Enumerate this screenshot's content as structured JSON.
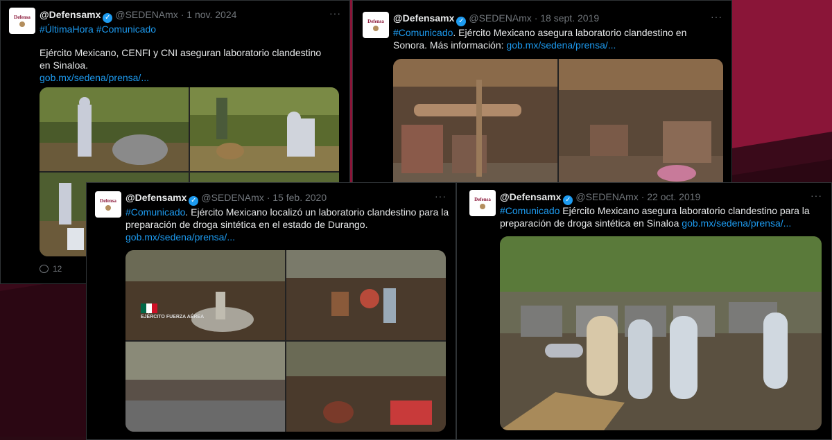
{
  "colors": {
    "brand": "#8a1538",
    "card_bg": "#000000",
    "link": "#1d9bf0",
    "muted": "#71767b",
    "text": "#e7e9ea",
    "verified": "#1d9bf0"
  },
  "avatar_label": "Defensa",
  "tweets": [
    {
      "name": "@Defensamx",
      "handle": "@SEDENAmx",
      "date": "1 nov. 2024",
      "hashtags": "#ÚltimaHora #Comunicado",
      "body": "Ejército Mexicano, CENFI y CNI aseguran laboratorio clandestino en Sinaloa.",
      "link": "gob.mx/sedena/prensa/...",
      "replies": "12"
    },
    {
      "name": "@Defensamx",
      "handle": "@SEDENAmx",
      "date": "18 sept. 2019",
      "hashtag": "#Comunicado",
      "body": ". Ejército Mexicano asegura laboratorio clandestino en Sonora. Más información:",
      "link": "gob.mx/sedena/prensa/..."
    },
    {
      "name": "@Defensamx",
      "handle": "@SEDENAmx",
      "date": "15 feb. 2020",
      "hashtag": "#Comunicado",
      "body": ". Ejército Mexicano localizó un laboratorio clandestino para la preparación de droga sintética en el estado de Durango.",
      "link": "gob.mx/sedena/prensa/...",
      "watermark": "EJÉRCITO FUERZA AÉREA"
    },
    {
      "name": "@Defensamx",
      "handle": "@SEDENAmx",
      "date": "22 oct. 2019",
      "hashtag": "#Comunicado",
      "body": " Ejército Mexicano asegura laboratorio clandestino para la preparación de droga sintética en Sinaloa",
      "link": "gob.mx/sedena/prensa/..."
    }
  ]
}
